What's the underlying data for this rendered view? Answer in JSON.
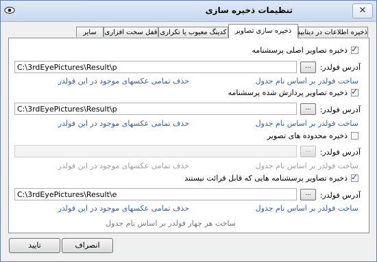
{
  "window": {
    "title": "تنظیمات ذخیره سازی",
    "close_glyph": "✕"
  },
  "tabs": [
    "ذخیره اطلاعات در دیتابیس",
    "ذخیره سازی تصاویر",
    "کدینگ معیوب یا تکراری",
    "قفل سخت افزاری",
    "سایر"
  ],
  "active_tab": 1,
  "sections": [
    {
      "checked": true,
      "label": "ذخیره تصاویر اصلی پرسشنامه",
      "folder_label": "آدرس فولدر:",
      "path": "C:\\3rdEyePictures\\Result\\p",
      "browse_label": "...",
      "link_build": "ساخت فولدر بر اساس نام جدول",
      "link_delete": "حذف تمامی عکسهای موجود در این فولدر",
      "enabled": true
    },
    {
      "checked": true,
      "label": "ذخیره تصاویر پردازش شده پرسشنامه",
      "folder_label": "آدرس فولدر:",
      "path": "C:\\3rdEyePictures\\Result\\p",
      "browse_label": "...",
      "link_build": "ساخت فولدر بر اساس نام جدول",
      "link_delete": "حذف تمامی عکسهای موجود در این فولدر",
      "enabled": true
    },
    {
      "checked": false,
      "label": "ذخیره محدوده های تصویر",
      "folder_label": "آدرس فولدر:",
      "path": "",
      "browse_label": "...",
      "link_build": "ساخت فولدر بر اساس نام جدول",
      "link_delete": "حذف تمامی عکسهای موجود در این فولدر",
      "enabled": false
    },
    {
      "checked": true,
      "label": "ذخیره تصاویر پرسشنامه هایی که قابل قرائت نیستند",
      "folder_label": "آدرس فولدر:",
      "path": "C:\\3rdEyePictures\\Result\\e",
      "browse_label": "...",
      "link_build": "ساخت فولدر بر اساس نام جدول",
      "link_delete": "حذف تمامی عکسهای موجود در این فولدر",
      "enabled": true
    }
  ],
  "note_four_folders": "ساخت هر چهار فولدر بر اساس نام جدول",
  "buttons": {
    "cancel": "انصراف",
    "ok": "تایید"
  },
  "check_glyph": "✓",
  "icons": {
    "system": "eye-icon",
    "close": "close-icon"
  }
}
